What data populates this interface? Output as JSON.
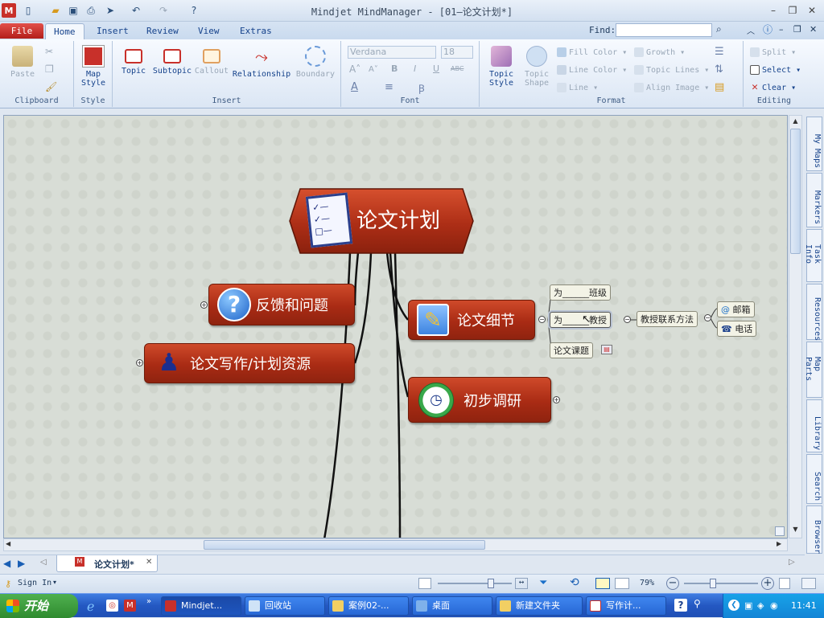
{
  "window": {
    "title": "Mindjet MindManager - [01—论文计划*]"
  },
  "tabs": {
    "file": "File",
    "home": "Home",
    "insert": "Insert",
    "review": "Review",
    "view": "View",
    "extras": "Extras"
  },
  "find": {
    "label": "Find:",
    "value": ""
  },
  "ribbon": {
    "clipboard": {
      "label": "Clipboard",
      "paste": "Paste"
    },
    "style": {
      "label": "Style",
      "map_style": "Map",
      "map_style2": "Style"
    },
    "insert": {
      "label": "Insert",
      "topic": "Topic",
      "subtopic": "Subtopic",
      "callout": "Callout",
      "relationship": "Relationship",
      "boundary": "Boundary"
    },
    "font": {
      "label": "Font",
      "family": "Verdana",
      "size": "18",
      "bold": "B",
      "italic": "I",
      "underline": "U",
      "strike": "ABC"
    },
    "format": {
      "label": "Format",
      "topic_style": "Topic",
      "topic_style2": "Style",
      "topic_shape": "Topic",
      "topic_shape2": "Shape",
      "fill_color": "Fill Color",
      "line_color": "Line Color",
      "line": "Line",
      "growth": "Growth",
      "topic_lines": "Topic Lines",
      "align_image": "Align Image"
    },
    "editing": {
      "label": "Editing",
      "split": "Split",
      "select": "Select",
      "clear": "Clear"
    }
  },
  "map": {
    "central": "论文计划",
    "topics": {
      "feedback": "反馈和问题",
      "writing": "论文写作/计划资源",
      "details": "论文细节",
      "research": "初步调研"
    },
    "subtopics": {
      "class": "为______班级",
      "professor": "为______教授",
      "contact": "教授联系方法",
      "email": "邮箱",
      "phone": "电话",
      "subject": "论文课题"
    }
  },
  "sidebar": [
    "My Maps",
    "Markers",
    "Task Info",
    "Resources",
    "Map Parts",
    "Library",
    "Search",
    "Browser"
  ],
  "doc_tab": {
    "name": "论文计划*"
  },
  "status": {
    "sign_in": "Sign In",
    "zoom": "79%"
  },
  "taskbar": {
    "start": "开始",
    "items": [
      "Mindjet...",
      "回收站",
      "案例02-...",
      "桌面",
      "新建文件夹",
      "写作计..."
    ],
    "clock": "11:41"
  },
  "colors": {
    "topic_red": "#b3311a",
    "file_tab": "#c8302a",
    "taskbar_blue": "#2458c2"
  }
}
